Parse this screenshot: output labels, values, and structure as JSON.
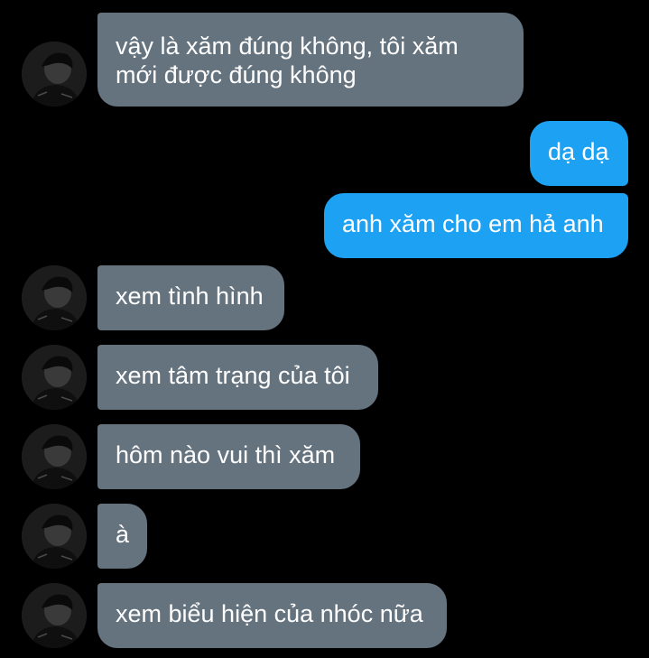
{
  "messages": [
    {
      "sender": "them",
      "text": "vậy là xăm đúng không, tôi xăm\nmới được đúng không"
    },
    {
      "sender": "me",
      "text": "dạ dạ"
    },
    {
      "sender": "me",
      "text": "anh xăm cho em hả anh"
    },
    {
      "sender": "them",
      "text": "xem tình hình"
    },
    {
      "sender": "them",
      "text": "xem tâm trạng của tôi"
    },
    {
      "sender": "them",
      "text": "hôm nào vui thì xăm"
    },
    {
      "sender": "them",
      "text": "à"
    },
    {
      "sender": "them",
      "text": "xem biểu hiện của nhóc nữa"
    }
  ],
  "colors": {
    "background": "#000000",
    "incoming_bubble": "#65737f",
    "outgoing_bubble": "#1da1f2",
    "text": "#ffffff"
  },
  "icons": {
    "avatar": "contact-avatar-photo"
  }
}
